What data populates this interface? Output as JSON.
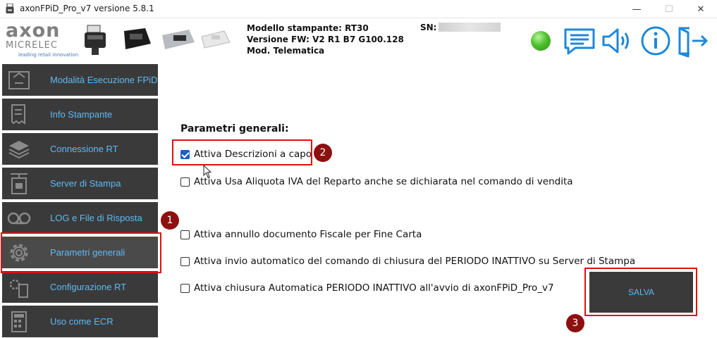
{
  "window": {
    "title": "axonFPiD_Pro_v7 versione 5.8.1",
    "minimize_glyph": "—",
    "maximize_glyph": "☐",
    "close_glyph": "✕"
  },
  "header": {
    "logo_main": "axon",
    "logo_sub": "MICRELEC",
    "logo_tagline": "leading retail innovation",
    "model_line": "Modello stampante: RT30",
    "fw_line": "Versione FW: V2 R1 B7 G100.128",
    "mode_line": "Mod. Telematica",
    "sn_label": "SN:",
    "status_color": "#4fc12d",
    "icons": [
      "messages-icon",
      "speaker-icon",
      "info-icon",
      "exit-icon"
    ],
    "accent_color": "#1e88d8"
  },
  "sidebar": {
    "items": [
      {
        "label": "Modalità Esecuzione FPiD",
        "icon": "fpid-mode-icon"
      },
      {
        "label": "Info Stampante",
        "icon": "receipt-icon"
      },
      {
        "label": "Connessione RT",
        "icon": "layers-icon"
      },
      {
        "label": "Server di Stampa",
        "icon": "print-server-icon"
      },
      {
        "label": "LOG e File di Risposta",
        "icon": "tape-icon"
      },
      {
        "label": "Parametri generali",
        "icon": "gear-icon"
      },
      {
        "label": "Configurazione RT",
        "icon": "config-icon"
      },
      {
        "label": "Uso come ECR",
        "icon": "calculator-icon"
      }
    ],
    "active_index": 5
  },
  "main": {
    "section_title": "Parametri generali:",
    "options": [
      {
        "label": "Attiva Descrizioni a capo",
        "checked": true
      },
      {
        "label": "Attiva Usa Aliquota IVA del Reparto anche se dichiarata nel comando di vendita",
        "checked": false
      },
      {
        "label": "Attiva annullo documento Fiscale per Fine Carta",
        "checked": false
      },
      {
        "label": "Attiva invio automatico del comando di chiusura del PERIODO INATTIVO su Server di Stampa",
        "checked": false
      },
      {
        "label": "Attiva chiusura Automatica PERIODO INATTIVO all'avvio di axonFPiD_Pro_v7",
        "checked": false
      }
    ],
    "save_label": "SALVA"
  },
  "annotations": {
    "badges": [
      "1",
      "2",
      "3"
    ],
    "highlight_color": "#e01010",
    "badge_color": "#8e0f10"
  }
}
